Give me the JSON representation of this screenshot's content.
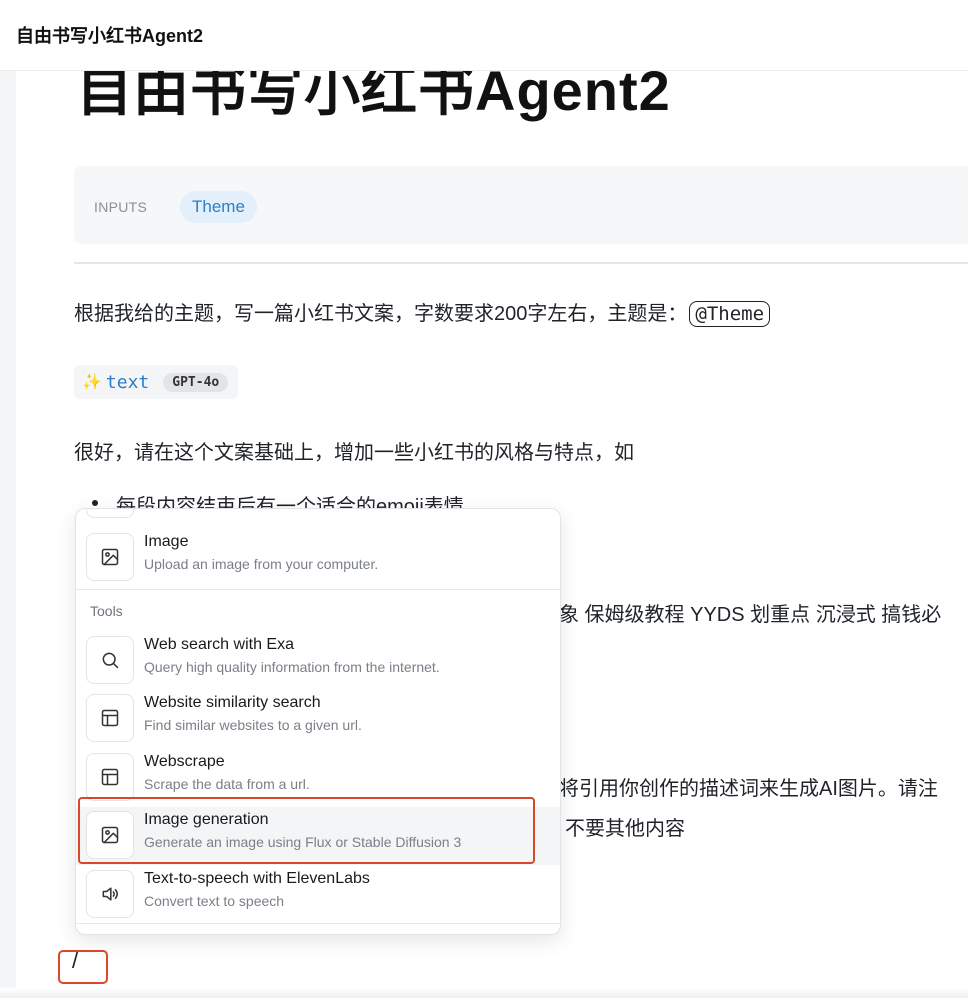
{
  "window": {
    "title": "自由书写小红书Agent2"
  },
  "document": {
    "heading": "自由书写小红书Agent2",
    "inputs": {
      "label": "INPUTS",
      "chips": [
        "Theme"
      ]
    },
    "prompt_line_1": {
      "text": "根据我给的主题，写一篇小红书文案，字数要求200字左右，主题是：",
      "mention": "@Theme"
    },
    "generation": {
      "sparkle": "✨",
      "name": "text",
      "model": "GPT-4o"
    },
    "prompt_line_2": "很好，请在这个文案基础上，增加一些小红书的风格与特点，如",
    "bullet_1": "每段内容结束后有一个适合的emoji表情",
    "cut_line_a": "象 保姆级教程 YYDS 划重点 沉浸式 搞钱必",
    "cut_line_b": "将引用你创作的描述词来生成AI图片。请注",
    "cut_line_c": "不要其他内容",
    "slash_input": "/"
  },
  "menu": {
    "items_top": [
      {
        "title": "Image",
        "desc": "Upload an image from your computer.",
        "icon": "image-icon"
      }
    ],
    "section_label": "Tools",
    "tools": [
      {
        "title": "Web search with Exa",
        "desc": "Query high quality information from the internet.",
        "icon": "search-icon"
      },
      {
        "title": "Website similarity search",
        "desc": "Find similar websites to a given url.",
        "icon": "layout-icon"
      },
      {
        "title": "Webscrape",
        "desc": "Scrape the data from a url.",
        "icon": "layout-icon"
      },
      {
        "title": "Image generation",
        "desc": "Generate an image using Flux or Stable Diffusion 3",
        "icon": "image-icon"
      },
      {
        "title": "Text-to-speech with ElevenLabs",
        "desc": "Convert text to speech",
        "icon": "speaker-icon"
      }
    ]
  },
  "colors": {
    "accent_blue": "#2b7fc4",
    "highlight_red": "#d9472b",
    "chip_bg": "#e3effa"
  }
}
